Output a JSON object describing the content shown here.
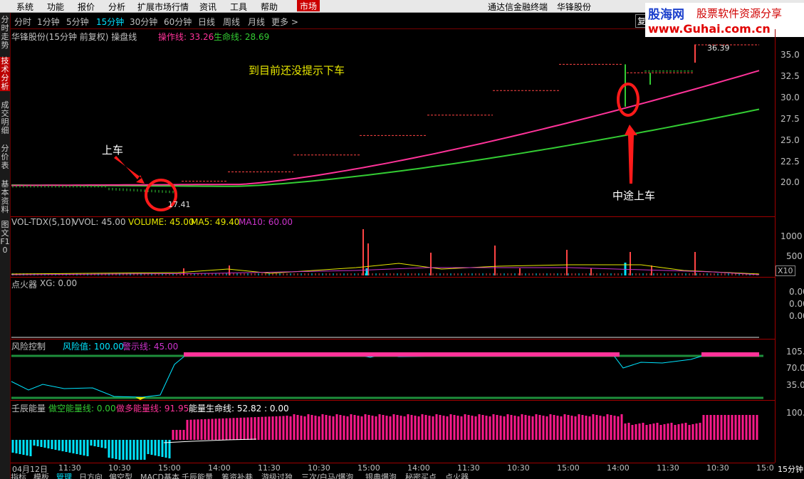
{
  "menu": {
    "items": [
      "系统",
      "功能",
      "报价",
      "分析",
      "扩展市场行情",
      "资讯",
      "工具",
      "帮助"
    ],
    "active": "市场",
    "terminal_title": "通达信金融终端",
    "stock_title": "华锋股份"
  },
  "left_tabs": [
    "分时走势",
    "技术分析",
    "成交明细",
    "分价表",
    "基本资料",
    "图文F10"
  ],
  "periods": [
    "分时",
    "1分钟",
    "5分钟",
    "15分钟",
    "30分钟",
    "60分钟",
    "日线",
    "周线",
    "月线",
    "更多 >"
  ],
  "active_period": "15分钟",
  "right_button": "复",
  "logo": {
    "brand": "股海网",
    "slogan": "股票软件资源分享",
    "url": "www.Guhai.com.cn"
  },
  "main_panel": {
    "title": "华锋股份(15分钟 前复权) 操盘线",
    "op_line_label": "操作线: 33.26",
    "life_line_label": "生命线: 28.69",
    "annotation_top": "到目前还没提示下车",
    "annotation_board": "上车",
    "annotation_mid": "中途上车",
    "low_label": "17.41",
    "high_label": "36.39",
    "y_ticks": [
      "35.0",
      "32.5",
      "30.0",
      "27.5",
      "25.0",
      "22.5",
      "20.0"
    ]
  },
  "vol_panel": {
    "title": "VOL-TDX(5,10)",
    "vvol": "VVOL: 45.00",
    "volume": "VOLUME: 45.00",
    "ma5": "MA5: 49.40",
    "ma10": "MA10: 60.00",
    "y_ticks": [
      "1000",
      "500"
    ],
    "unit": "X10"
  },
  "ignite_panel": {
    "title": "点火器",
    "xg": "XG: 0.00",
    "y_ticks": [
      "0.00",
      "0.00",
      "0.00"
    ]
  },
  "risk_panel": {
    "title": "风险控制",
    "risk_value": "风险值: 100.00",
    "warn_line": "警示线: 45.00",
    "y_ticks": [
      "105.",
      "70.0",
      "35.0"
    ]
  },
  "energy_panel": {
    "title": "壬辰能量",
    "short_line": "做空能量线: 0.00",
    "long_line": "做多能量线: 91.95",
    "life_line": "能量生命线: 52.82 : 0.00",
    "y_ticks": [
      "100."
    ]
  },
  "time_axis": [
    "04月12日",
    "11:30",
    "10:30",
    "15:00",
    "14:00",
    "11:30",
    "10:30",
    "15:00",
    "14:00",
    "11:30",
    "10:30",
    "15:00",
    "14:00",
    "11:30",
    "10:30",
    "15:0"
  ],
  "period_indicator": "15分钟",
  "bottom_tabs": [
    "指标",
    "模板",
    "管理",
    "日方向",
    "偏空型",
    "MACD基本",
    "壬辰能量",
    "筹资补巷",
    "游级过独",
    "三次/白马/爆泡",
    "银典爆泡",
    "秘密买点",
    "点火器"
  ],
  "colors": {
    "op_line": "#ff3399",
    "life_line": "#33cc33",
    "ma10": "#cc33cc",
    "cyan": "#00e5ff",
    "accent_red": "#cc0000",
    "yellow": "#e8e800"
  }
}
